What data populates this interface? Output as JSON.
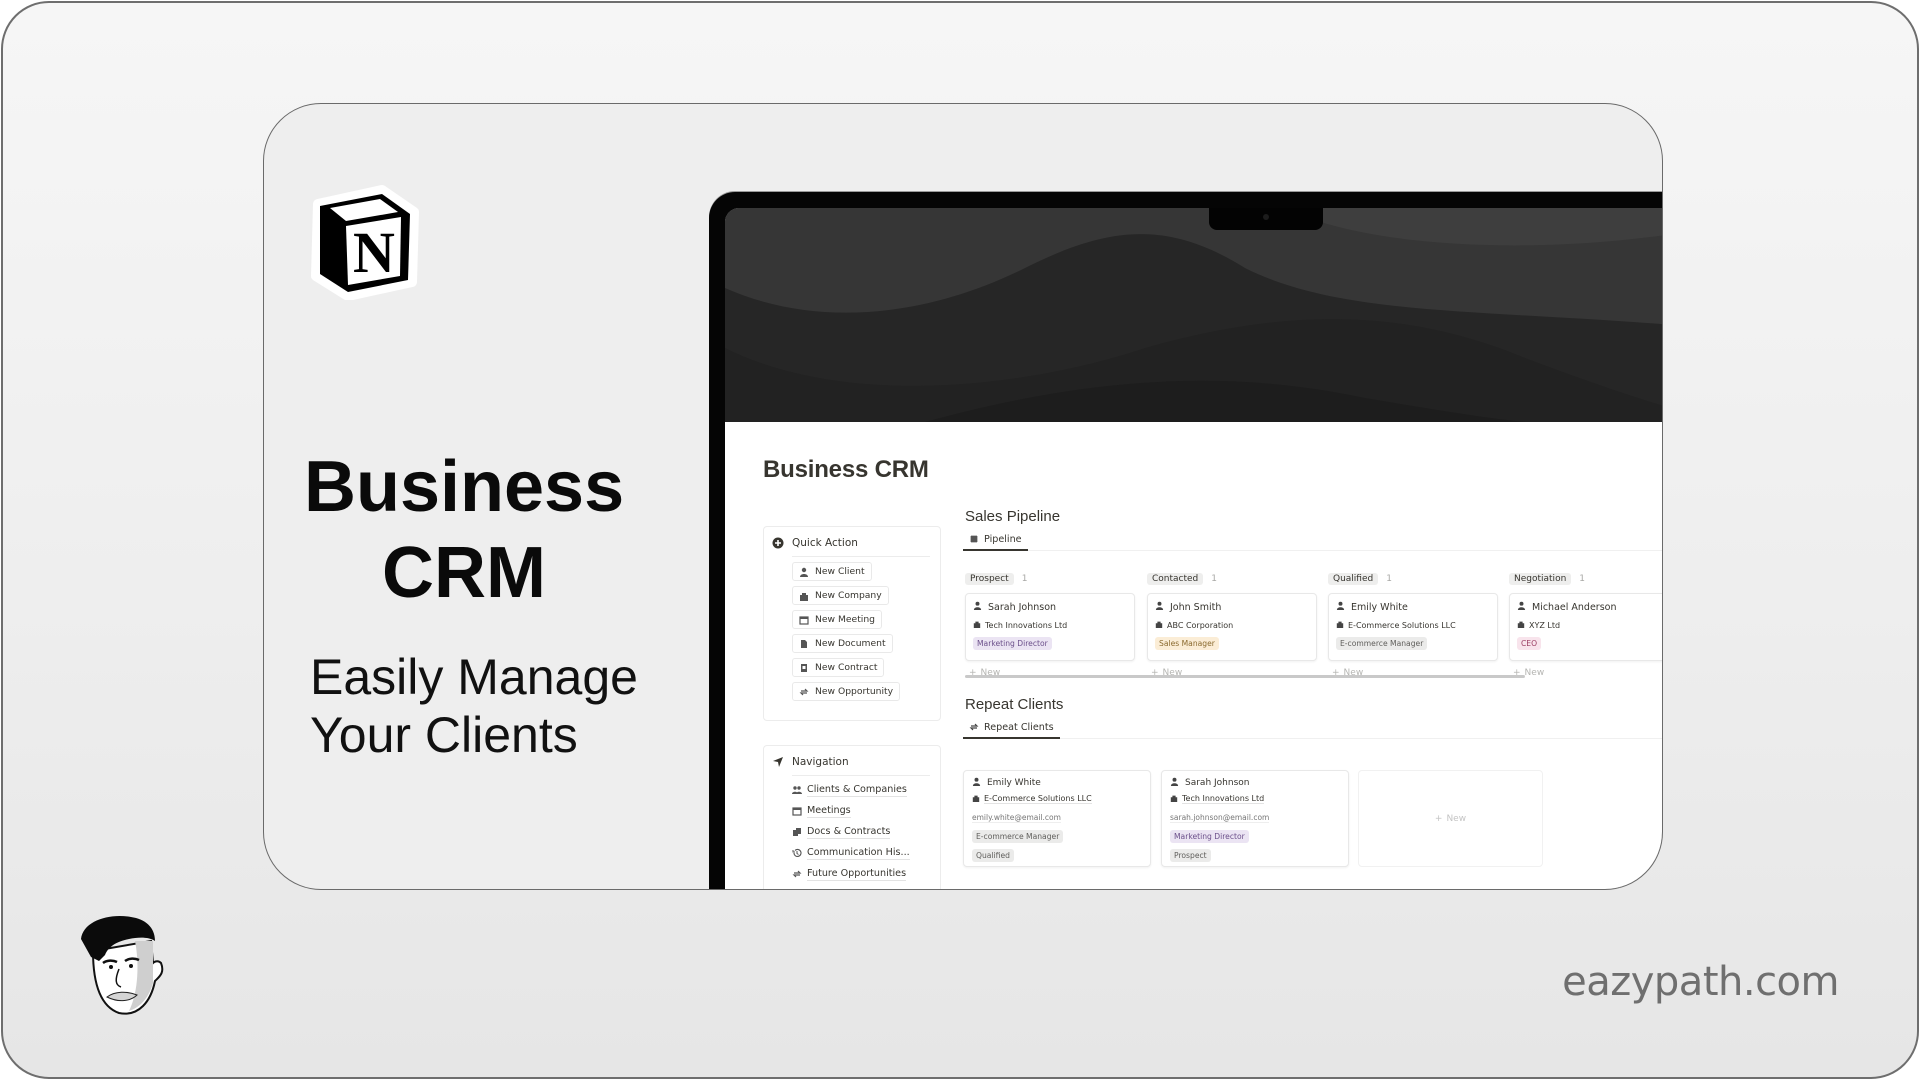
{
  "promo": {
    "title_line1": "Business",
    "title_line2": "CRM",
    "subtitle_line1": "Easily Manage",
    "subtitle_line2": "Your Clients",
    "website": "eazypath.com",
    "logo": "notion-logo-icon",
    "avatar": "author-avatar-illustration"
  },
  "colors": {
    "tag_purple_bg": "#ebe4f3",
    "tag_purple_fg": "#6b4f8a",
    "tag_yellow_bg": "#fbedd6",
    "tag_yellow_fg": "#8a6a2f",
    "tag_gray_bg": "#ebebea",
    "tag_gray_fg": "#5f5e5b",
    "tag_pink_bg": "#f8e4ec",
    "tag_pink_fg": "#9b3e63"
  },
  "notion": {
    "page_title": "Business CRM",
    "quick_action": {
      "heading": "Quick Action",
      "icon": "plus-circle-icon",
      "buttons": [
        {
          "label": "New Client",
          "icon": "person-icon"
        },
        {
          "label": "New Company",
          "icon": "building-icon"
        },
        {
          "label": "New Meeting",
          "icon": "calendar-icon"
        },
        {
          "label": "New Document",
          "icon": "document-icon"
        },
        {
          "label": "New Contract",
          "icon": "contract-icon"
        },
        {
          "label": "New Opportunity",
          "icon": "repeat-icon"
        }
      ]
    },
    "navigation": {
      "heading": "Navigation",
      "icon": "navigation-arrow-icon",
      "links": [
        {
          "label": "Clients & Companies",
          "icon": "people-icon"
        },
        {
          "label": "Meetings",
          "icon": "calendar-icon"
        },
        {
          "label": "Docs & Contracts",
          "icon": "documents-icon"
        },
        {
          "label": "Communication His...",
          "icon": "history-icon"
        },
        {
          "label": "Future Opportunities",
          "icon": "repeat-icon"
        }
      ]
    },
    "sales_pipeline": {
      "title": "Sales Pipeline",
      "tab": {
        "label": "Pipeline",
        "icon": "chip-icon"
      },
      "new_label": "New",
      "columns": [
        {
          "label": "Prospect",
          "count": "1",
          "card": {
            "name": "Sarah Johnson",
            "company": "Tech Innovations Ltd",
            "role": "Marketing Director",
            "role_color": "purple"
          }
        },
        {
          "label": "Contacted",
          "count": "1",
          "card": {
            "name": "John Smith",
            "company": "ABC Corporation",
            "role": "Sales Manager",
            "role_color": "yellow"
          }
        },
        {
          "label": "Qualified",
          "count": "1",
          "card": {
            "name": "Emily White",
            "company": "E-Commerce Solutions LLC",
            "role": "E-commerce Manager",
            "role_color": "gray"
          }
        },
        {
          "label": "Negotiation",
          "count": "1",
          "card": {
            "name": "Michael Anderson",
            "company": "XYZ Ltd",
            "role": "CEO",
            "role_color": "pink"
          }
        }
      ]
    },
    "repeat_clients": {
      "title": "Repeat Clients",
      "tab": {
        "label": "Repeat Clients",
        "icon": "repeat-icon"
      },
      "new_label": "New",
      "cards": [
        {
          "name": "Emily White",
          "company": "E-Commerce Solutions LLC",
          "email": "emily.white@email.com",
          "role": "E-commerce Manager",
          "status": "Qualified"
        },
        {
          "name": "Sarah Johnson",
          "company": "Tech Innovations Ltd",
          "email": "sarah.johnson@email.com",
          "role": "Marketing Director",
          "status": "Prospect"
        }
      ]
    },
    "next_section_title": "Future Opportunities"
  }
}
